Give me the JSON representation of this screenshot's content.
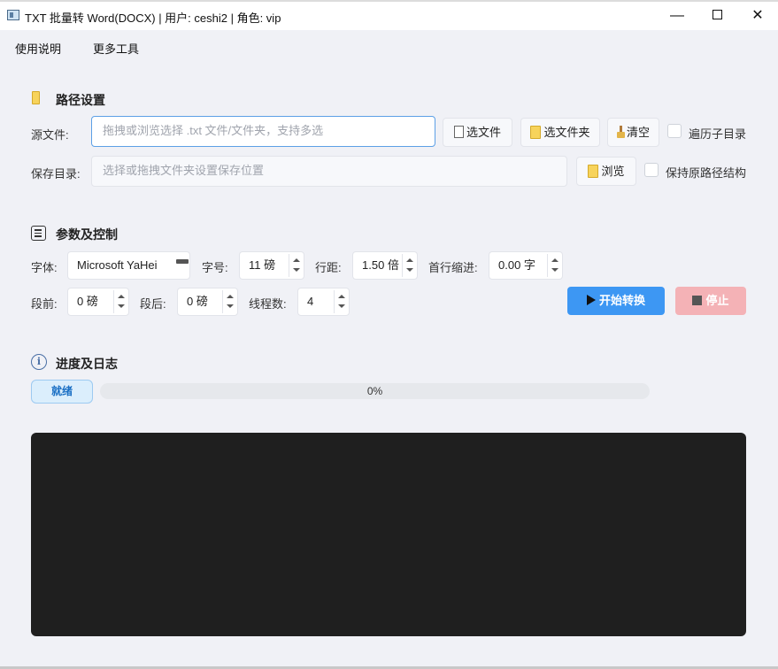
{
  "window": {
    "title": "TXT 批量转 Word(DOCX)  |  用户: ceshi2  |  角色: vip",
    "minimize": "—",
    "close": "✕"
  },
  "menu": {
    "items": [
      "使用说明",
      "更多工具"
    ]
  },
  "path_settings": {
    "title": "路径设置",
    "icon": "folder-icon",
    "source_label": "源文件:",
    "source_placeholder": "拖拽或浏览选择 .txt 文件/文件夹，支持多选",
    "select_file": "选文件",
    "select_folder": "选文件夹",
    "clear": "清空",
    "recursive_label": "遍历子目录",
    "save_label": "保存目录:",
    "save_placeholder": "选择或拖拽文件夹设置保存位置",
    "browse": "浏览",
    "keep_structure_label": "保持原路径结构"
  },
  "params": {
    "title": "参数及控制",
    "icon": "list-icon",
    "font_label": "字体:",
    "font_value": "Microsoft YaHei",
    "size_label": "字号:",
    "size_value": "11 磅",
    "line_spacing_label": "行距:",
    "line_spacing_value": "1.50 倍",
    "indent_label": "首行缩进:",
    "indent_value": "0.00 字",
    "before_label": "段前:",
    "before_value": "0 磅",
    "after_label": "段后:",
    "after_value": "0 磅",
    "threads_label": "线程数:",
    "threads_value": "4",
    "start": "开始转换",
    "stop": "停止"
  },
  "progress": {
    "title": "进度及日志",
    "icon": "info-icon",
    "status": "就绪",
    "percent_label": "0%",
    "value": 0
  },
  "colors": {
    "accent": "#3d97f3",
    "stop": "#f4b2b6",
    "status_bg": "#dbeefc",
    "log_bg": "#1f1f1f"
  }
}
